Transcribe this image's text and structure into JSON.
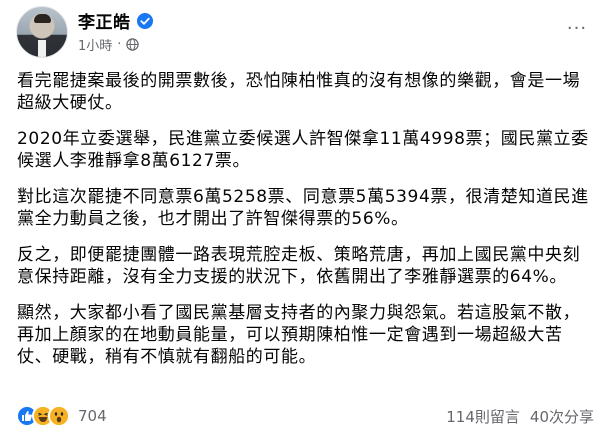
{
  "post": {
    "author": "李正皓",
    "time": "1小時",
    "separator": "·",
    "more_label": "···",
    "paragraphs": [
      "看完罷捷案最後的開票數後，恐怕陳柏惟真的沒有想像的樂觀，會是一場超級大硬仗。",
      "2020年立委選舉，民進黨立委候選人許智傑拿11萬4998票；國民黨立委候選人李雅靜拿8萬6127票。",
      "對比這次罷捷不同意票6萬5258票、同意票5萬5394票，很清楚知道民進黨全力動員之後，也才開出了許智傑得票的56%。",
      "反之，即便罷捷團體一路表現荒腔走板、策略荒唐，再加上國民黨中央刻意保持距離，沒有全力支援的狀況下，依舊開出了李雅靜選票的64%。",
      "顯然，大家都小看了國民黨基層支持者的內聚力與怨氣。若這股氣不散，再加上顏家的在地動員能量，可以預期陳柏惟一定會遇到一場超級大苦仗、硬戰，稍有不慎就有翻船的可能。"
    ],
    "reactions": {
      "icons": [
        "like-icon",
        "haha-icon",
        "wow-icon"
      ],
      "count": "704"
    },
    "comments": "114則留言",
    "shares": "40次分享"
  },
  "colors": {
    "like": "#1877f2",
    "haha": "#f7b125",
    "meta_text": "#65676b",
    "verified": "#1877f2"
  }
}
